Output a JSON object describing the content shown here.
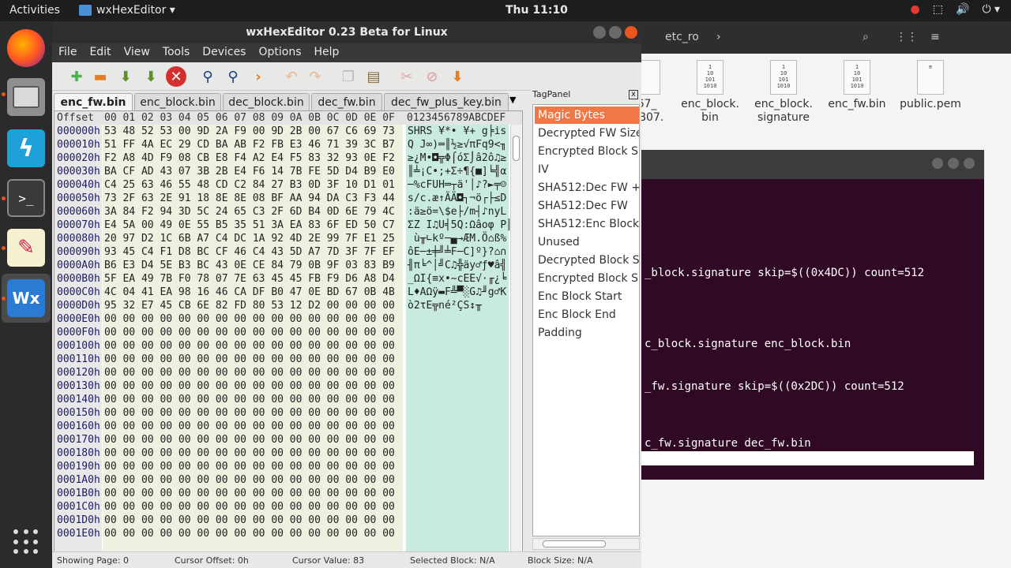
{
  "topbar": {
    "activities": "Activities",
    "app_name": "wxHexEditor ▾",
    "clock": "Thu 11:10",
    "tray": [
      "●",
      "⬚",
      "🔊",
      "⏻ ▾"
    ]
  },
  "dock": {
    "items": [
      "firefox-icon",
      "files-icon",
      "zap-icon",
      "terminal-icon",
      "text-editor-icon",
      "wxhexeditor-icon",
      "app-grid-icon"
    ],
    "terminal_glyph": ">_",
    "wx_glyph": "Wx",
    "zap_glyph": "ϟ",
    "edit_glyph": "✎"
  },
  "filemanager": {
    "path_segment": "etc_ro",
    "files": [
      {
        "name": "67_\nDB07.",
        "partial": true
      },
      {
        "name": "enc_block.\nbin"
      },
      {
        "name": "enc_block.\nsignature"
      },
      {
        "name": "enc_fw.bin"
      },
      {
        "name": "public.pem"
      }
    ]
  },
  "terminal": {
    "lines": [
      "_block.signature skip=$((0x4DC)) count=512",
      "c_block.signature enc_block.bin",
      "_fw.signature skip=$((0x2DC)) count=512",
      "c_fw.signature dec_fw.bin"
    ]
  },
  "window": {
    "title": "wxHexEditor 0.23 Beta for Linux",
    "menu": [
      "File",
      "Edit",
      "View",
      "Tools",
      "Devices",
      "Options",
      "Help"
    ],
    "tabs": [
      "enc_fw.bin",
      "enc_block.bin",
      "dec_block.bin",
      "dec_fw.bin",
      "dec_fw_plus_key.bin"
    ],
    "tab_menu": "▼",
    "hex": {
      "offset_header": "Offset",
      "col_header": "00 01 02 03 04 05 06 07 08 09 0A 0B 0C 0D 0E 0F",
      "text_header": "0123456789ABCDEF",
      "rows": [
        {
          "off": "000000h",
          "hex": "53 48 52 53 00 9D 2A F9 00 9D 2B 00 67 C6 69 73",
          "txt": "SHRS ¥*• ¥+ g╞is"
        },
        {
          "off": "000010h",
          "hex": "51 FF 4A EC 29 CD BA AB F2 FB E3 46 71 39 3C B7",
          "txt": "Q J∞)═║½≥√πFq9<╖"
        },
        {
          "off": "000020h",
          "hex": "F2 A8 4D F9 08 CB E8 F4 A2 E4 F5 83 32 93 0E F2",
          "txt": "≥¿M•◘╦Φ⌠óΣ⌡â2ô♫≥"
        },
        {
          "off": "000030h",
          "hex": "BA CF AD 43 07 3B 2B E4 F6 14 7B FE 5D D4 B9 E0",
          "txt": "║╧¡C•;+Σ÷¶{■]╘╣α"
        },
        {
          "off": "000040h",
          "hex": "C4 25 63 46 55 48 CD C2 84 27 B3 0D 3F 10 D1 01",
          "txt": "─%cFUH═┬ä'│♪?►╤☺"
        },
        {
          "off": "000050h",
          "hex": "73 2F 63 2E 91 18 8E 8E 08 BF AA 94 DA C3 F3 44",
          "txt": "s/c.æ↑ÄÄ◘┐¬ö┌├≤D"
        },
        {
          "off": "000060h",
          "hex": "3A 84 F2 94 3D 5C 24 65 C3 2F 6D B4 0D 6E 79 4C",
          "txt": ":ä≥ö=\\$e├/m┤♪nyL"
        },
        {
          "off": "000070h",
          "hex": "E4 5A 00 49 0E 55 B5 35 51 3A EA 83 6F ED 50 C7",
          "txt": "ΣZ I♫U╡5Q:Ωâoφ P╟"
        },
        {
          "off": "000080h",
          "hex": "20 97 D2 1C 6B A7 C4 DC 1A 92 4D 2E 99 7F E1 25",
          "txt": " ù╥∟kº─▄→ÆM.Ö⌂ß%"
        },
        {
          "off": "000090h",
          "hex": "93 45 C4 F1 D8 BC CF 46 C4 43 5D A7 7D 3F 7F EF",
          "txt": "ôE─±╪╝╧F─C]º}?⌂∩"
        },
        {
          "off": "0000A0h",
          "hex": "B6 E3 D4 5E B3 BC 43 0E CE 84 79 0B 9F 03 83 B9",
          "txt": "╢π╘^│╝C♫╬äy♂ƒ♥â╣"
        },
        {
          "off": "0000B0h",
          "hex": "5F EA 49 7B F0 78 07 7E 63 45 45 FB F9 D6 A8 D4",
          "txt": "_ΩI{≡x•~cEE√·╓¿╘"
        },
        {
          "off": "0000C0h",
          "hex": "4C 04 41 EA 98 16 46 CA DF B0 47 0E BD 67 0B 4B",
          "txt": "L♦AΩÿ▬F╩▀░G♫╜g♂K"
        },
        {
          "off": "0000D0h",
          "hex": "95 32 E7 45 CB 6E 82 FD 80 53 12 D2 00 00 00 00",
          "txt": "ò2τE╦né²ÇS↕╥"
        },
        {
          "off": "0000E0h",
          "hex": "00 00 00 00 00 00 00 00 00 00 00 00 00 00 00 00",
          "txt": ""
        },
        {
          "off": "0000F0h",
          "hex": "00 00 00 00 00 00 00 00 00 00 00 00 00 00 00 00",
          "txt": ""
        },
        {
          "off": "000100h",
          "hex": "00 00 00 00 00 00 00 00 00 00 00 00 00 00 00 00",
          "txt": ""
        },
        {
          "off": "000110h",
          "hex": "00 00 00 00 00 00 00 00 00 00 00 00 00 00 00 00",
          "txt": ""
        },
        {
          "off": "000120h",
          "hex": "00 00 00 00 00 00 00 00 00 00 00 00 00 00 00 00",
          "txt": ""
        },
        {
          "off": "000130h",
          "hex": "00 00 00 00 00 00 00 00 00 00 00 00 00 00 00 00",
          "txt": ""
        },
        {
          "off": "000140h",
          "hex": "00 00 00 00 00 00 00 00 00 00 00 00 00 00 00 00",
          "txt": ""
        },
        {
          "off": "000150h",
          "hex": "00 00 00 00 00 00 00 00 00 00 00 00 00 00 00 00",
          "txt": ""
        },
        {
          "off": "000160h",
          "hex": "00 00 00 00 00 00 00 00 00 00 00 00 00 00 00 00",
          "txt": ""
        },
        {
          "off": "000170h",
          "hex": "00 00 00 00 00 00 00 00 00 00 00 00 00 00 00 00",
          "txt": ""
        },
        {
          "off": "000180h",
          "hex": "00 00 00 00 00 00 00 00 00 00 00 00 00 00 00 00",
          "txt": ""
        },
        {
          "off": "000190h",
          "hex": "00 00 00 00 00 00 00 00 00 00 00 00 00 00 00 00",
          "txt": ""
        },
        {
          "off": "0001A0h",
          "hex": "00 00 00 00 00 00 00 00 00 00 00 00 00 00 00 00",
          "txt": ""
        },
        {
          "off": "0001B0h",
          "hex": "00 00 00 00 00 00 00 00 00 00 00 00 00 00 00 00",
          "txt": ""
        },
        {
          "off": "0001C0h",
          "hex": "00 00 00 00 00 00 00 00 00 00 00 00 00 00 00 00",
          "txt": ""
        },
        {
          "off": "0001D0h",
          "hex": "00 00 00 00 00 00 00 00 00 00 00 00 00 00 00 00",
          "txt": ""
        },
        {
          "off": "0001E0h",
          "hex": "00 00 00 00 00 00 00 00 00 00 00 00 00 00 00 00",
          "txt": ""
        }
      ]
    },
    "tagpanel": {
      "title": "TagPanel",
      "close": "x",
      "tags": [
        "Magic Bytes",
        "Decrypted FW Size",
        "Encrypted Block Siz",
        "IV",
        "SHA512:Dec FW + K",
        "SHA512:Dec FW",
        "SHA512:Enc Block",
        "Unused",
        "Decrypted Block Sig",
        "Encrypted Block Sig",
        "Enc Block Start",
        "Enc Block End",
        "Padding"
      ],
      "selected": "Magic Bytes"
    },
    "status": {
      "page": "Showing Page: 0",
      "cursor_offset": "Cursor Offset: 0h",
      "cursor_value": "Cursor Value: 83",
      "selected_block": "Selected Block: N/A",
      "block_size": "Block Size: N/A"
    }
  },
  "colors": {
    "accent": "#e95420",
    "tag_selected": "#f07746",
    "terminal_bg": "#300a24",
    "text_col_bg": "#c8eadf",
    "hex_col_bg": "#f0f0e0"
  }
}
